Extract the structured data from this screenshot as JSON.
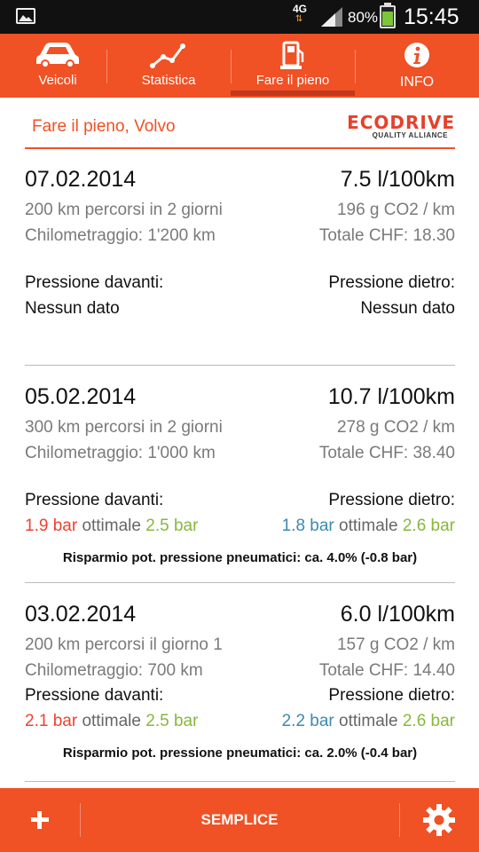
{
  "status_bar": {
    "network": "4G",
    "battery": "80%",
    "battery_level": 0.8,
    "time": "15:45"
  },
  "tabs": [
    {
      "label": "Veicoli",
      "icon": "car-icon",
      "active": false
    },
    {
      "label": "Statistica",
      "icon": "chart-line-icon",
      "active": false
    },
    {
      "label": "Fare il pieno",
      "icon": "fuel-pump-icon",
      "active": true
    },
    {
      "label": "INFO",
      "icon": "info-icon",
      "active": false
    }
  ],
  "header": {
    "title": "Fare il pieno, Volvo",
    "logo_main": "ECODRIVE",
    "logo_sub": "QUALITY ALLIANCE"
  },
  "entries": [
    {
      "date": "07.02.2014",
      "consumption": "7.5 l/100km",
      "distance": "200 km percorsi in 2 giorni",
      "co2": "196 g CO2 / km",
      "mileage": "Chilometraggio: 1'200 km",
      "total": "Totale CHF: 18.30",
      "front_label": "Pressione davanti:",
      "rear_label": "Pressione dietro:",
      "front_none": "Nessun dato",
      "rear_none": "Nessun dato"
    },
    {
      "date": "05.02.2014",
      "consumption": "10.7 l/100km",
      "distance": "300 km percorsi in 2 giorni",
      "co2": "278 g CO2 / km",
      "mileage": "Chilometraggio: 1'000 km",
      "total": "Totale CHF: 38.40",
      "front_label": "Pressione davanti:",
      "rear_label": "Pressione dietro:",
      "front_actual": "1.9 bar",
      "front_word": "ottimale",
      "front_optimal": "2.5 bar",
      "rear_actual": "1.8 bar",
      "rear_word": "ottimale",
      "rear_optimal": "2.6 bar",
      "saving": "Risparmio pot. pressione pneumatici: ca. 4.0% (-0.8 bar)"
    },
    {
      "date": "03.02.2014",
      "consumption": "6.0 l/100km",
      "distance": "200 km percorsi il giorno 1",
      "co2": "157 g CO2 / km",
      "mileage": "Chilometraggio: 700 km",
      "total": "Totale CHF: 14.40",
      "front_label": "Pressione davanti:",
      "rear_label": "Pressione dietro:",
      "front_actual": "2.1 bar",
      "front_word": "ottimale",
      "front_optimal": "2.5 bar",
      "rear_actual": "2.2 bar",
      "rear_word": "ottimale",
      "rear_optimal": "2.6 bar",
      "saving": "Risparmio pot. pressione pneumatici: ca. 2.0% (-0.4 bar)"
    }
  ],
  "bottom_bar": {
    "add_icon": "plus-icon",
    "mode_label": "SEMPLICE",
    "settings_icon": "gear-icon"
  },
  "colors": {
    "accent": "#f05125",
    "red_value": "#ef4230",
    "green_value": "#86b83b",
    "blue_value": "#3a8ab0"
  }
}
